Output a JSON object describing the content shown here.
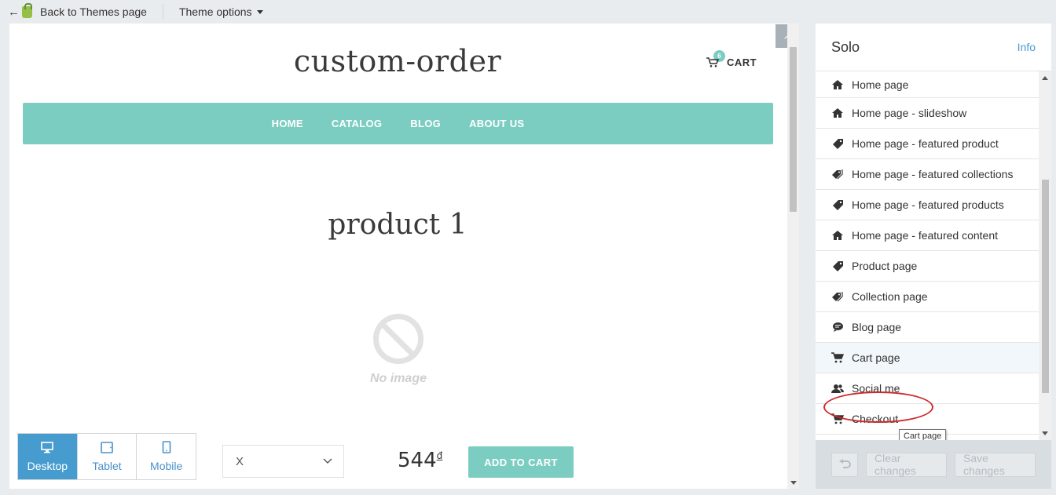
{
  "topbar": {
    "back_label": "Back to Themes page",
    "theme_options_label": "Theme options"
  },
  "preview": {
    "store_title": "custom-order",
    "cart_label": "CART",
    "cart_count": "6",
    "nav": [
      "HOME",
      "CATALOG",
      "BLOG",
      "ABOUT US"
    ],
    "product_title": "product 1",
    "no_image_label": "No image",
    "variant_value": "X",
    "price": "544",
    "currency": "đ",
    "add_to_cart_label": "ADD TO CART",
    "colors": {
      "accent": "#7ccdc1"
    }
  },
  "device_switch": {
    "items": [
      {
        "label": "Desktop",
        "icon": "desktop-icon",
        "active": true
      },
      {
        "label": "Tablet",
        "icon": "tablet-icon",
        "active": false
      },
      {
        "label": "Mobile",
        "icon": "mobile-icon",
        "active": false
      }
    ]
  },
  "sidebar": {
    "title": "Solo",
    "info_label": "Info",
    "items": [
      {
        "label": "Home page",
        "icon": "home-icon"
      },
      {
        "label": "Home page - slideshow",
        "icon": "home-icon"
      },
      {
        "label": "Home page - featured product",
        "icon": "tag-icon"
      },
      {
        "label": "Home page - featured collections",
        "icon": "tags-icon"
      },
      {
        "label": "Home page - featured products",
        "icon": "tag-icon"
      },
      {
        "label": "Home page - featured content",
        "icon": "home-icon"
      },
      {
        "label": "Product page",
        "icon": "tag-icon"
      },
      {
        "label": "Collection page",
        "icon": "tags-icon"
      },
      {
        "label": "Blog page",
        "icon": "chat-icon"
      },
      {
        "label": "Cart page",
        "icon": "cart-icon"
      },
      {
        "label": "Social me",
        "icon": "users-icon"
      },
      {
        "label": "Checkout",
        "icon": "cart-icon"
      }
    ],
    "tooltip": "Cart page",
    "footer": {
      "clear_label": "Clear changes",
      "save_label": "Save changes"
    }
  }
}
